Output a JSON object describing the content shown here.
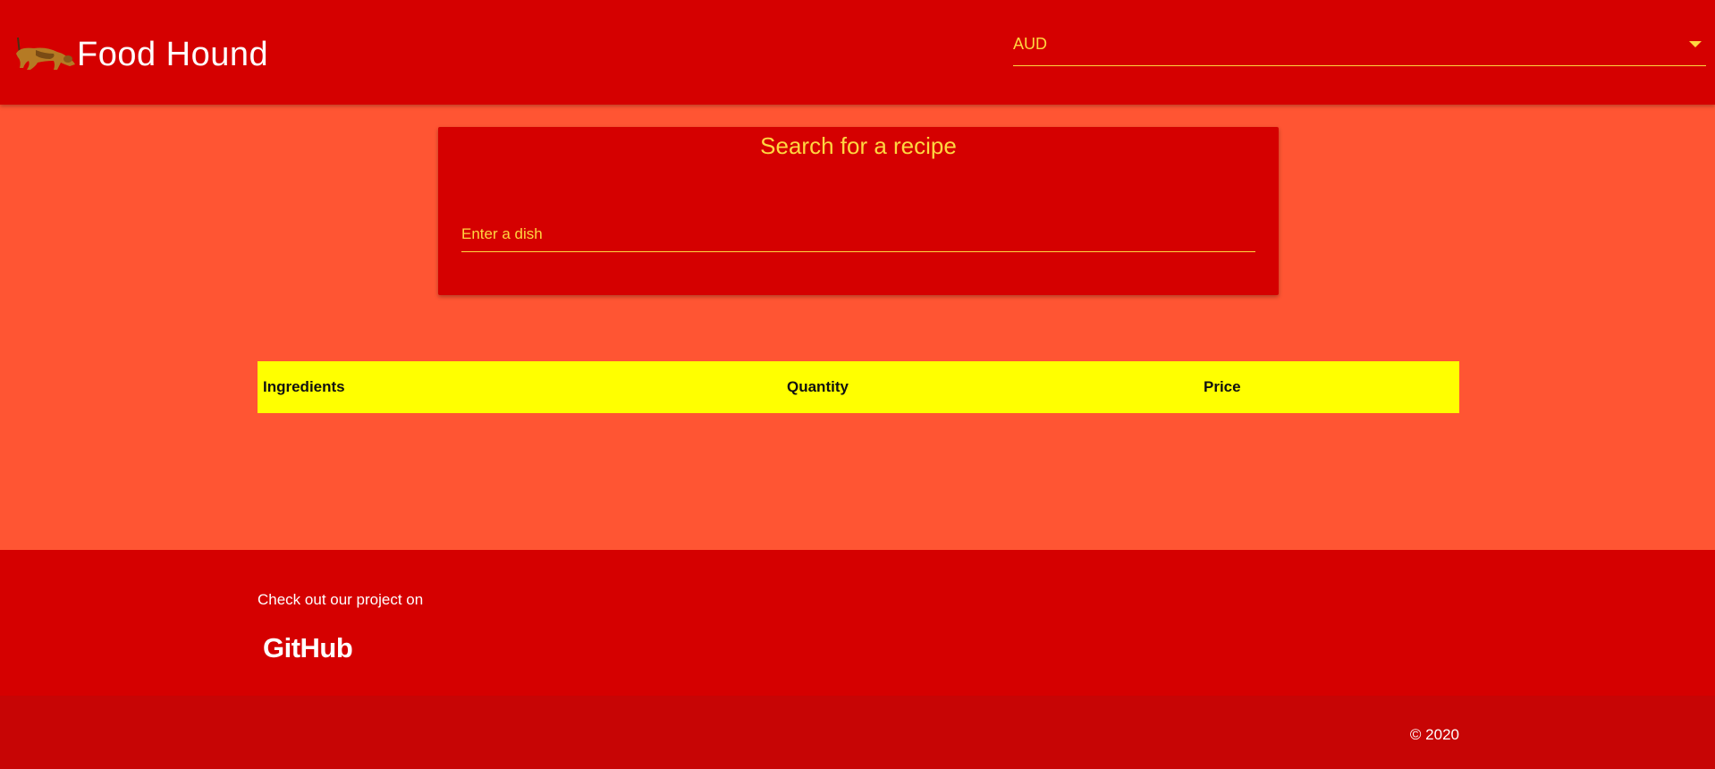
{
  "header": {
    "brand_title": "Food Hound",
    "logo_icon": "dog-icon",
    "currency": {
      "selected": "AUD",
      "caret_icon": "dropdown-caret-icon"
    }
  },
  "search": {
    "title": "Search for a recipe",
    "placeholder": "Enter a dish",
    "value": ""
  },
  "table": {
    "columns": [
      "Ingredients",
      "Quantity",
      "Price"
    ]
  },
  "footer": {
    "text": "Check out our project on",
    "github_label": "GitHub",
    "copyright": "© 2020"
  },
  "colors": {
    "navbar": "#d50000",
    "background": "#ff5533",
    "accent": "#ffd740",
    "table_header": "#ffff00",
    "footer": "#d50000",
    "copyright_bar": "#c70505"
  }
}
